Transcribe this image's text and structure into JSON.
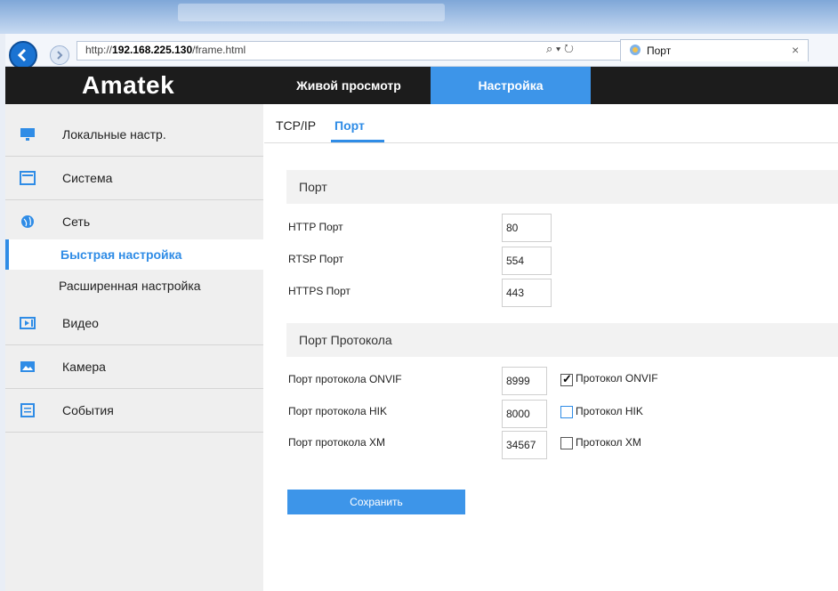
{
  "browser": {
    "url_prefix": "http://",
    "url_host": "192.168.225.130",
    "url_path": "/frame.html",
    "url_tools": "⌕ ▾ ↻",
    "tab_title": "Порт",
    "tab_close": "×"
  },
  "header": {
    "logo": "Amatek",
    "nav_live": "Живой просмотр",
    "nav_settings": "Настройка"
  },
  "sidebar": {
    "items": [
      {
        "label": "Локальные настр.",
        "icon": "monitor-icon"
      },
      {
        "label": "Система",
        "icon": "system-icon"
      },
      {
        "label": "Сеть",
        "icon": "globe-icon"
      },
      {
        "label": "Видео",
        "icon": "video-icon"
      },
      {
        "label": "Камера",
        "icon": "image-icon"
      },
      {
        "label": "События",
        "icon": "list-icon"
      }
    ],
    "subitems": [
      {
        "label": "Быстрая настройка",
        "active": true
      },
      {
        "label": "Расширенная настройка",
        "active": false
      }
    ]
  },
  "tabs": {
    "tcp": "TCP/IP",
    "port": "Порт"
  },
  "port_section": {
    "title": "Порт",
    "rows": [
      {
        "label": "HTTP Порт",
        "value": "80"
      },
      {
        "label": "RTSP Порт",
        "value": "554"
      },
      {
        "label": "HTTPS Порт",
        "value": "443"
      }
    ]
  },
  "protocol_section": {
    "title": "Порт Протокола",
    "rows": [
      {
        "label": "Порт протокола ONVIF",
        "value": "8999",
        "check_label": "Протокол ONVIF",
        "checked": true
      },
      {
        "label": "Порт протокола HIK",
        "value": "8000",
        "check_label": "Протокол HIK",
        "checked": false
      },
      {
        "label": "Порт протокола XM",
        "value": "34567",
        "check_label": "Протокол XM",
        "checked": false
      }
    ]
  },
  "actions": {
    "save": "Сохранить"
  },
  "colors": {
    "accent": "#3d95e9",
    "header_bg": "#1c1c1c",
    "sidebar_bg": "#efefef"
  }
}
